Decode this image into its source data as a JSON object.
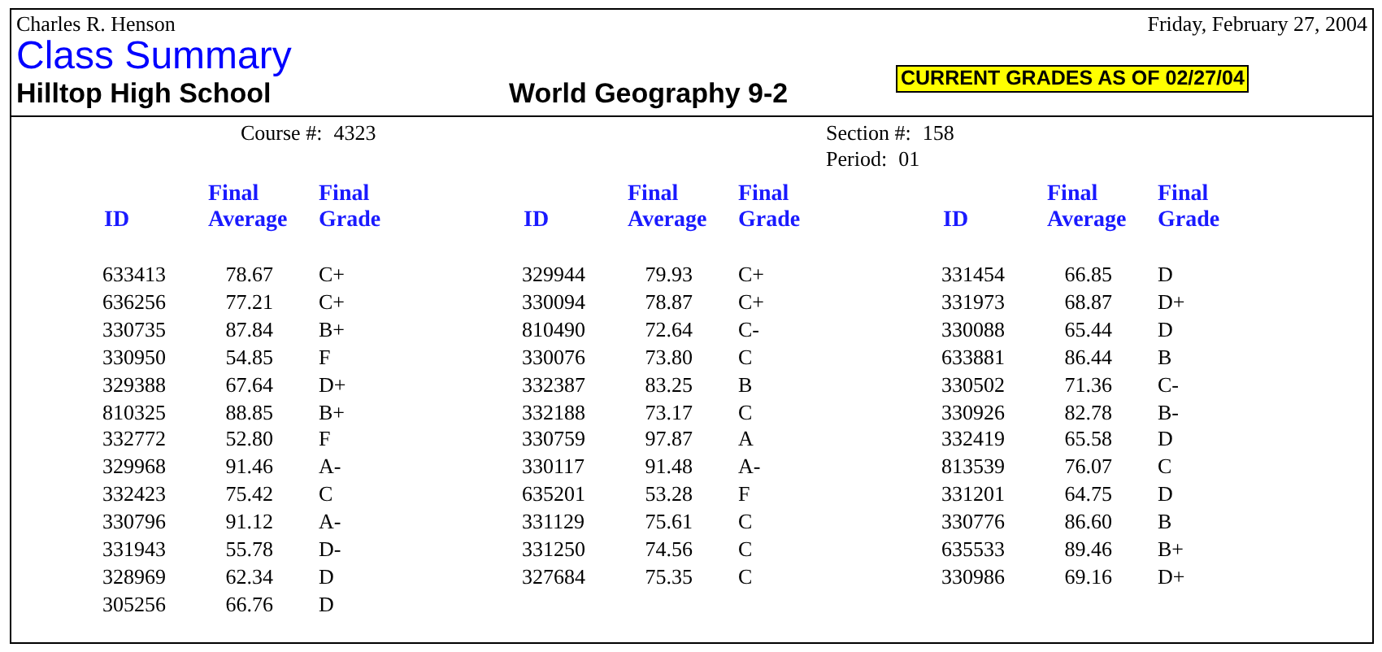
{
  "header": {
    "teacher": "Charles R. Henson",
    "date": "Friday, February 27, 2004",
    "title": "Class Summary",
    "school": "Hilltop High School",
    "course_title": "World Geography 9-2",
    "notice": "CURRENT GRADES AS OF 02/27/04"
  },
  "info": {
    "course": {
      "label": "Course #:",
      "value": "4323"
    },
    "section": {
      "label": "Section #:",
      "value": "158"
    },
    "period": {
      "label": "Period:",
      "value": "01"
    }
  },
  "groups": [
    {
      "columns": {
        "id": "ID",
        "average": "Final Average",
        "grade": "Final Grade"
      },
      "rows": [
        [
          "633413",
          "78.67",
          "C+"
        ],
        [
          "636256",
          "77.21",
          "C+"
        ],
        [
          "330735",
          "87.84",
          "B+"
        ],
        [
          "330950",
          "54.85",
          "F"
        ],
        [
          "329388",
          "67.64",
          "D+"
        ],
        [
          "810325",
          "88.85",
          "B+"
        ],
        [
          "332772",
          "52.80",
          "F"
        ],
        [
          "329968",
          "91.46",
          "A-"
        ],
        [
          "332423",
          "75.42",
          "C"
        ],
        [
          "330796",
          "91.12",
          "A-"
        ],
        [
          "331943",
          "55.78",
          "D-"
        ],
        [
          "328969",
          "62.34",
          "D"
        ],
        [
          "305256",
          "66.76",
          "D"
        ]
      ]
    },
    {
      "columns": {
        "id": "ID",
        "average": "Final Average",
        "grade": "Final Grade"
      },
      "rows": [
        [
          "329944",
          "79.93",
          "C+"
        ],
        [
          "330094",
          "78.87",
          "C+"
        ],
        [
          "810490",
          "72.64",
          "C-"
        ],
        [
          "330076",
          "73.80",
          "C"
        ],
        [
          "332387",
          "83.25",
          "B"
        ],
        [
          "332188",
          "73.17",
          "C"
        ],
        [
          "330759",
          "97.87",
          "A"
        ],
        [
          "330117",
          "91.48",
          "A-"
        ],
        [
          "635201",
          "53.28",
          "F"
        ],
        [
          "331129",
          "75.61",
          "C"
        ],
        [
          "331250",
          "74.56",
          "C"
        ],
        [
          "327684",
          "75.35",
          "C"
        ]
      ]
    },
    {
      "columns": {
        "id": "ID",
        "average": "Final Average",
        "grade": "Final Grade"
      },
      "rows": [
        [
          "331454",
          "66.85",
          "D"
        ],
        [
          "331973",
          "68.87",
          "D+"
        ],
        [
          "330088",
          "65.44",
          "D"
        ],
        [
          "633881",
          "86.44",
          "B"
        ],
        [
          "330502",
          "71.36",
          "C-"
        ],
        [
          "330926",
          "82.78",
          "B-"
        ],
        [
          "332419",
          "65.58",
          "D"
        ],
        [
          "813539",
          "76.07",
          "C"
        ],
        [
          "331201",
          "64.75",
          "D"
        ],
        [
          "330776",
          "86.60",
          "B"
        ],
        [
          "635533",
          "89.46",
          "B+"
        ],
        [
          "330986",
          "69.16",
          "D+"
        ]
      ]
    }
  ]
}
